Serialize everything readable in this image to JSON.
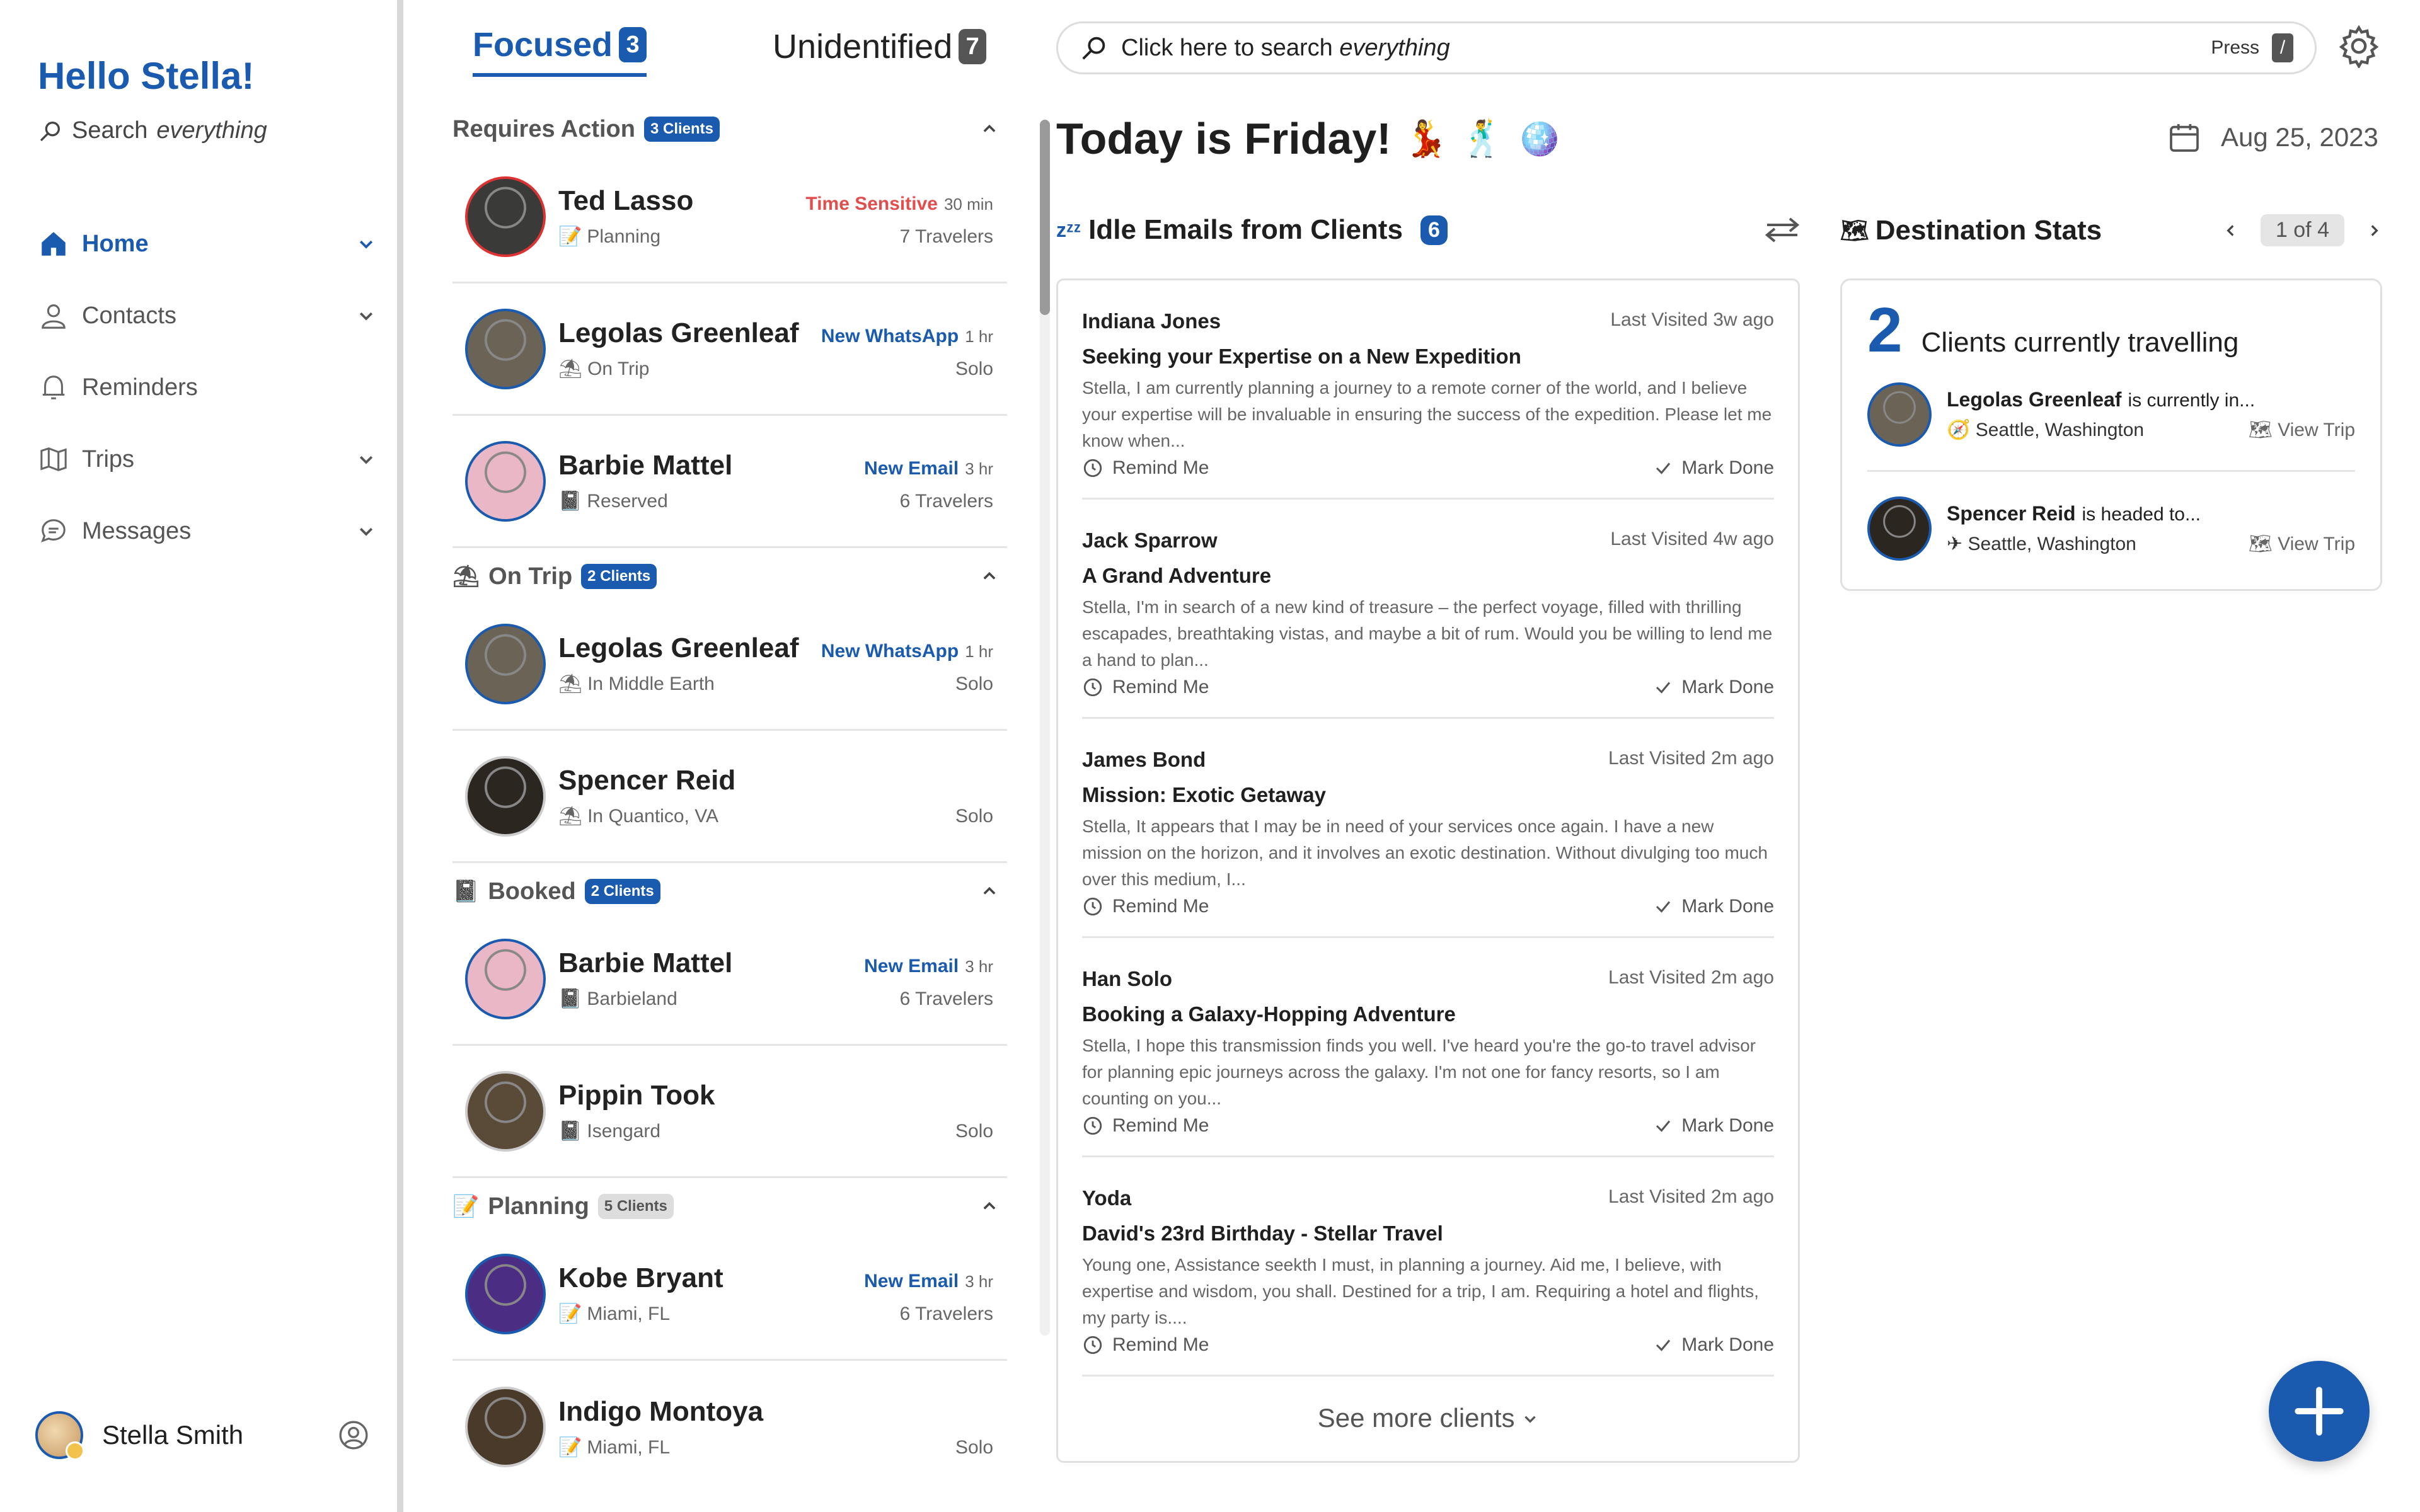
{
  "sidebar": {
    "greeting": "Hello Stella!",
    "search_placeholder": "Search everything",
    "search_prefix": "Search",
    "search_suffix": "everything",
    "nav": [
      {
        "label": "Home",
        "icon": "home-icon",
        "active": true,
        "expandable": true
      },
      {
        "label": "Contacts",
        "icon": "person-icon",
        "active": false,
        "expandable": true
      },
      {
        "label": "Reminders",
        "icon": "bell-icon",
        "active": false,
        "expandable": false
      },
      {
        "label": "Trips",
        "icon": "map-icon",
        "active": false,
        "expandable": true
      },
      {
        "label": "Messages",
        "icon": "chat-icon",
        "active": false,
        "expandable": true
      }
    ],
    "user_name": "Stella Smith"
  },
  "tabs": {
    "focused": {
      "label": "Focused",
      "count": "3"
    },
    "unidentified": {
      "label": "Unidentified",
      "count": "7"
    }
  },
  "sections": [
    {
      "title": "Requires Action",
      "emoji": "",
      "badge": "3 Clients",
      "clients": [
        {
          "name": "Ted Lasso",
          "tag": "Time Sensitive",
          "tag_color": "red",
          "time": "30 min",
          "status_emoji": "📝",
          "status": "Planning",
          "travelers": "7 Travelers",
          "ring": "red",
          "avatar": "#3a3a38"
        },
        {
          "name": "Legolas Greenleaf",
          "tag": "New WhatsApp",
          "tag_color": "blue",
          "time": "1 hr",
          "status_emoji": "⛱",
          "status": "On Trip",
          "travelers": "Solo",
          "ring": "blue",
          "avatar": "#6b6355"
        },
        {
          "name": "Barbie Mattel",
          "tag": "New Email",
          "tag_color": "blue",
          "time": "3 hr",
          "status_emoji": "📓",
          "status": "Reserved",
          "travelers": "6 Travelers",
          "ring": "blue",
          "avatar": "#e9b7c6"
        }
      ]
    },
    {
      "title": "On Trip",
      "emoji": "⛱",
      "badge": "2 Clients",
      "clients": [
        {
          "name": "Legolas Greenleaf",
          "tag": "New WhatsApp",
          "tag_color": "blue",
          "time": "1 hr",
          "status_emoji": "⛱",
          "status": "In Middle Earth",
          "travelers": "Solo",
          "ring": "blue",
          "avatar": "#6b6355"
        },
        {
          "name": "Spencer Reid",
          "tag": "",
          "tag_color": "blue",
          "time": "",
          "status_emoji": "⛱",
          "status": "In Quantico, VA",
          "travelers": "Solo",
          "ring": "grey",
          "avatar": "#2b2620"
        }
      ]
    },
    {
      "title": "Booked",
      "emoji": "📓",
      "badge": "2 Clients",
      "clients": [
        {
          "name": "Barbie Mattel",
          "tag": "New Email",
          "tag_color": "blue",
          "time": "3 hr",
          "status_emoji": "📓",
          "status": "Barbieland",
          "travelers": "6 Travelers",
          "ring": "blue",
          "avatar": "#e9b7c6"
        },
        {
          "name": "Pippin Took",
          "tag": "",
          "tag_color": "blue",
          "time": "",
          "status_emoji": "📓",
          "status": "Isengard",
          "travelers": "Solo",
          "ring": "grey",
          "avatar": "#5a4a38"
        }
      ]
    },
    {
      "title": "Planning",
      "emoji": "📝",
      "badge": "5 Clients",
      "badge_grey": true,
      "clients": [
        {
          "name": "Kobe Bryant",
          "tag": "New Email",
          "tag_color": "blue",
          "time": "3 hr",
          "status_emoji": "📝",
          "status": "Miami, FL",
          "travelers": "6 Travelers",
          "ring": "blue",
          "avatar": "#4b2e83"
        },
        {
          "name": "Indigo Montoya",
          "tag": "",
          "tag_color": "blue",
          "time": "",
          "status_emoji": "📝",
          "status": "Miami, FL",
          "travelers": "Solo",
          "ring": "grey",
          "avatar": "#4a3a2a"
        }
      ]
    }
  ],
  "search": {
    "prefix": "Click here to search",
    "emph": "everything",
    "press": "Press",
    "key": "/"
  },
  "header": {
    "today": "Today is Friday!",
    "emojis": [
      "💃",
      "🕺",
      "🪩"
    ],
    "date": "Aug 25, 2023"
  },
  "idle": {
    "title": "Idle Emails from Clients",
    "count": "6",
    "emails": [
      {
        "name": "Indiana Jones",
        "last": "Last Visited",
        "ago": "3w ago",
        "subject": "Seeking your Expertise on a New Expedition",
        "body": "Stella, I am currently planning a journey to a remote corner of the world, and I believe your expertise will be invaluable in ensuring the success of the expedition. Please let me know when...",
        "remind": "Remind Me",
        "done": "Mark Done"
      },
      {
        "name": "Jack Sparrow",
        "last": "Last Visited",
        "ago": "4w ago",
        "subject": "A Grand Adventure",
        "body": "Stella, I'm in search of a new kind of treasure – the perfect voyage, filled with thrilling escapades, breathtaking vistas, and maybe a bit of rum.  Would you be willing to lend me a hand to plan...",
        "remind": "Remind Me",
        "done": "Mark Done"
      },
      {
        "name": "James Bond",
        "last": "Last Visited",
        "ago": "2m ago",
        "subject": "Mission: Exotic Getaway",
        "body": "Stella, It appears that I may be in need of your services once again.  I have a new mission on the horizon, and it involves an exotic destination.  Without divulging too much over this medium, I...",
        "remind": "Remind Me",
        "done": "Mark Done"
      },
      {
        "name": "Han Solo",
        "last": "Last Visited",
        "ago": "2m ago",
        "subject": "Booking a Galaxy-Hopping Adventure",
        "body": "Stella, I hope this transmission finds you well.  I've heard you're the go-to travel advisor for planning epic journeys across the galaxy. I'm not one for fancy resorts, so I am counting on you...",
        "remind": "Remind Me",
        "done": "Mark Done"
      },
      {
        "name": "Yoda",
        "last": "Last Visited",
        "ago": "2m ago",
        "subject": "David's 23rd Birthday - Stellar Travel",
        "body": "Young one, Assistance seekth I must, in planning a journey.  Aid me, I believe, with expertise and wisdom, you shall.  Destined for a trip, I am.  Requiring a hotel and flights, my party is....",
        "remind": "Remind Me",
        "done": "Mark Done"
      }
    ],
    "see_more": "See more clients"
  },
  "destination": {
    "title": "Destination Stats",
    "page": "1 of 4",
    "count": "2",
    "count_label": "Clients currently travelling",
    "travellers": [
      {
        "name": "Legolas Greenleaf",
        "phrase": "is currently in...",
        "loc_emoji": "🧭",
        "location": "Seattle, Washington",
        "view": "View Trip",
        "avatar": "#6b6355"
      },
      {
        "name": "Spencer Reid",
        "phrase": "is headed to...",
        "loc_emoji": "✈",
        "location": "Seattle, Washington",
        "view": "View Trip",
        "avatar": "#2b2620"
      }
    ]
  },
  "colors": {
    "accent": "#1a5bb0",
    "alert": "#e24d4d"
  }
}
